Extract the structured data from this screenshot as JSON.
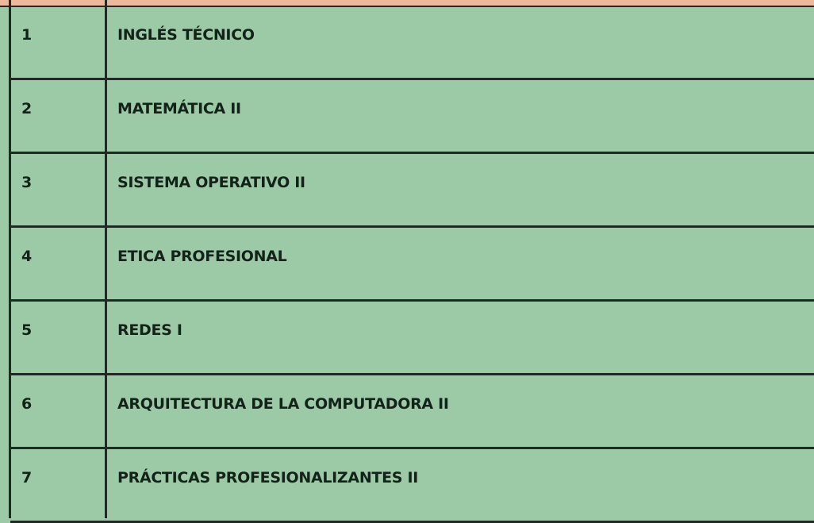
{
  "colors": {
    "background": "#9ccaa6",
    "header_strip": "#eeb89c",
    "lines": "#1f2a22",
    "text": "#14231a"
  },
  "rows": [
    {
      "number": "1",
      "subject": "INGLÉS TÉCNICO"
    },
    {
      "number": "2",
      "subject": "MATEMÁTICA II"
    },
    {
      "number": "3",
      "subject": "SISTEMA OPERATIVO II"
    },
    {
      "number": "4",
      "subject": "ETICA PROFESIONAL"
    },
    {
      "number": "5",
      "subject": "REDES I"
    },
    {
      "number": "6",
      "subject": "ARQUITECTURA DE LA COMPUTADORA II"
    },
    {
      "number": "7",
      "subject": "PRÁCTICAS PROFESIONALIZANTES II"
    }
  ]
}
